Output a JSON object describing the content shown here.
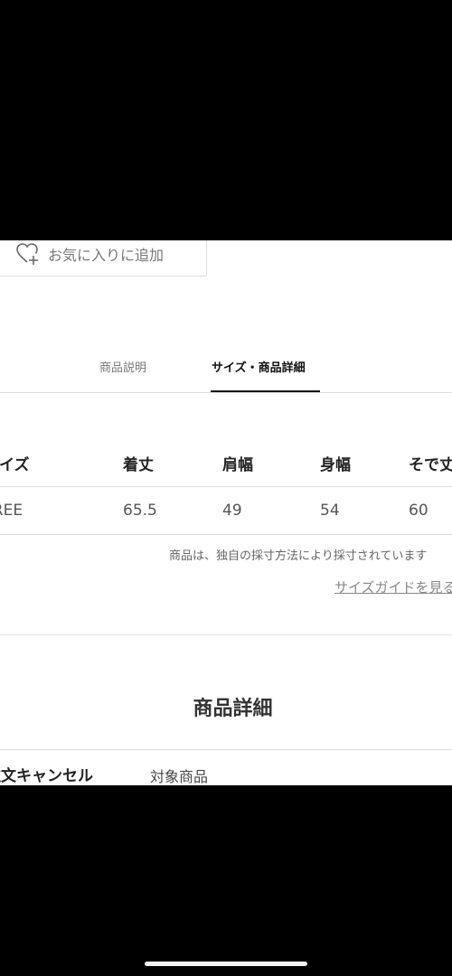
{
  "favorite_button": {
    "label": "お気に入りに追加",
    "icon": "heart-plus-icon"
  },
  "tabs": [
    {
      "label": "商品説明",
      "active": false
    },
    {
      "label": "サイズ・商品詳細",
      "active": true
    }
  ],
  "size_table": {
    "headers": [
      "サイズ",
      "着丈",
      "肩幅",
      "身幅",
      "そで丈"
    ],
    "rows": [
      [
        "FREE",
        "65.5",
        "49",
        "54",
        "60"
      ]
    ]
  },
  "measurement_note": "商品は、独自の採寸方法により採寸されています",
  "size_guide_link": "サイズガイドを見る",
  "product_details": {
    "title": "商品詳細",
    "rows": [
      {
        "key": "注文キャンセル",
        "value": "対象商品"
      }
    ]
  },
  "colors": {
    "background": "#000000",
    "content_background": "#ffffff",
    "active_tab": "#111111",
    "inactive_text": "#777777"
  }
}
